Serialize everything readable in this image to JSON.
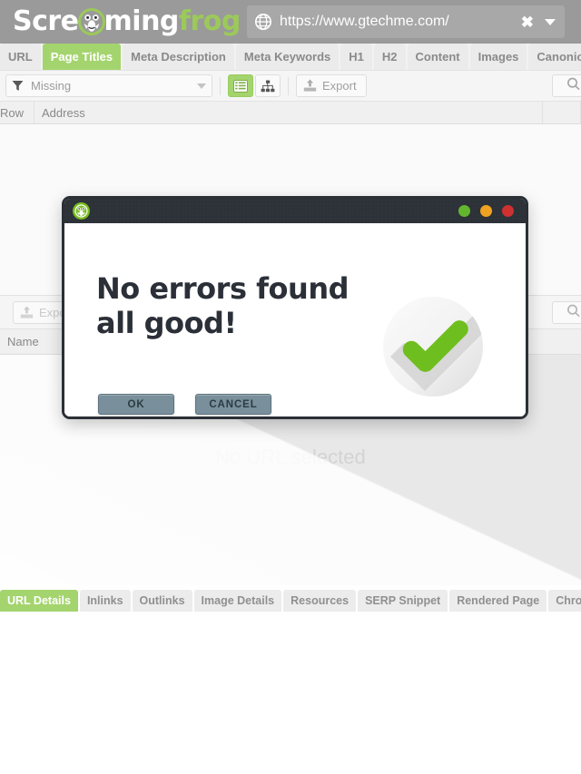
{
  "app": {
    "brand_white_1": "Scre",
    "brand_white_2": "ming",
    "brand_green": "frog",
    "brand_icon": "screaming-frog-logo"
  },
  "address_bar": {
    "globe_icon": "globe-icon",
    "url": "https://www.gtechme.com/",
    "clear_icon": "close-x-icon",
    "history_icon": "chevron-down-icon"
  },
  "tabs": [
    {
      "label": "URL",
      "active": false
    },
    {
      "label": "Page Titles",
      "active": true
    },
    {
      "label": "Meta Description",
      "active": false
    },
    {
      "label": "Meta Keywords",
      "active": false
    },
    {
      "label": "H1",
      "active": false
    },
    {
      "label": "H2",
      "active": false
    },
    {
      "label": "Content",
      "active": false
    },
    {
      "label": "Images",
      "active": false
    },
    {
      "label": "Canonicals",
      "active": false
    }
  ],
  "toolbar": {
    "filter_icon": "funnel-icon",
    "filter_value": "Missing",
    "dropdown_icon": "chevron-down-icon",
    "list_view_icon": "list-view-icon",
    "tree_view_icon": "tree-view-icon",
    "export_icon": "export-upload-icon",
    "export_label": "Export",
    "search_icon": "search-icon"
  },
  "table": {
    "columns": [
      "Row",
      "Address"
    ]
  },
  "lower_toolbar": {
    "export_icon": "export-upload-icon",
    "export_label": "Export",
    "search_icon": "search-icon"
  },
  "lower_table": {
    "columns": [
      "Name"
    ]
  },
  "detail_pane": {
    "empty_message": "No URL selected"
  },
  "bottom_tabs": [
    {
      "label": "URL Details",
      "active": true
    },
    {
      "label": "Inlinks",
      "active": false
    },
    {
      "label": "Outlinks",
      "active": false
    },
    {
      "label": "Image Details",
      "active": false
    },
    {
      "label": "Resources",
      "active": false
    },
    {
      "label": "SERP Snippet",
      "active": false
    },
    {
      "label": "Rendered Page",
      "active": false
    },
    {
      "label": "Chrome",
      "active": false
    }
  ],
  "dialog": {
    "title_icon": "screaming-frog-logo",
    "window_dots": [
      "green",
      "orange",
      "red"
    ],
    "heading": "No errors found\nall good!",
    "status_icon": "green-checkmark-icon",
    "buttons": [
      {
        "label": "OK"
      },
      {
        "label": "CANCEL"
      }
    ]
  },
  "colors": {
    "brand_green": "#9cc95a",
    "tab_active": "#a4d46e",
    "dialog_titlebar": "#2d3138",
    "dialog_heading": "#2b3038",
    "button_fill": "#79909c",
    "check_green": "#6fbe1f",
    "dot_green": "#63b72e",
    "dot_orange": "#f0a321",
    "dot_red": "#cf3030",
    "header_grey": "#9a9a9a"
  }
}
